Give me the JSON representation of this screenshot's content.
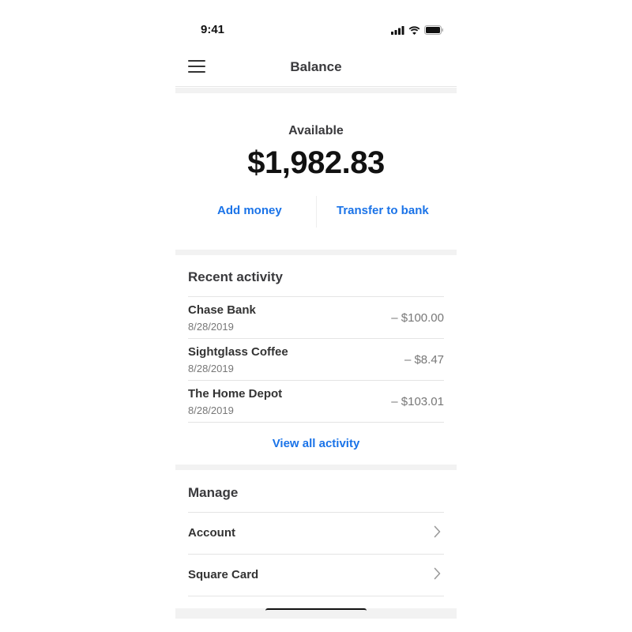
{
  "status_bar": {
    "time": "9:41",
    "icons": [
      "signal-icon",
      "wifi-icon",
      "battery-icon"
    ]
  },
  "header": {
    "title": "Balance",
    "menu_icon": "hamburger-menu-icon"
  },
  "balance": {
    "label": "Available",
    "amount": "$1,982.83",
    "actions": [
      {
        "label": "Add money"
      },
      {
        "label": "Transfer to bank"
      }
    ]
  },
  "recent_activity": {
    "title": "Recent activity",
    "items": [
      {
        "name": "Chase Bank",
        "date": "8/28/2019",
        "amount": "– $100.00"
      },
      {
        "name": "Sightglass Coffee",
        "date": "8/28/2019",
        "amount": "– $8.47"
      },
      {
        "name": "The Home Depot",
        "date": "8/28/2019",
        "amount": "– $103.01"
      }
    ],
    "view_all_label": "View all activity"
  },
  "manage": {
    "title": "Manage",
    "items": [
      {
        "label": "Account",
        "icon": "chevron-right-icon"
      },
      {
        "label": "Square Card",
        "icon": "chevron-right-icon"
      }
    ]
  },
  "colors": {
    "accent": "#1a73e8",
    "text_primary": "#333333",
    "text_secondary": "#777777",
    "section_band": "#f2f2f2"
  }
}
